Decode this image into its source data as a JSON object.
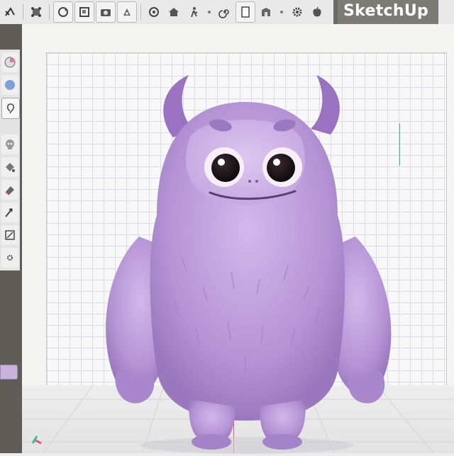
{
  "app": {
    "title": "SketchUp"
  },
  "toolbar": {
    "items": [
      {
        "name": "select-arrow-icon"
      },
      {
        "name": "component-icon"
      },
      {
        "name": "rotate-icon"
      },
      {
        "name": "frame-icon"
      },
      {
        "name": "camera-icon"
      },
      {
        "name": "paint-icon"
      },
      {
        "name": "orbit-icon"
      },
      {
        "name": "house-icon"
      },
      {
        "name": "walk-icon"
      },
      {
        "name": "spiral-icon"
      },
      {
        "name": "page-icon"
      },
      {
        "name": "warehouse-icon"
      },
      {
        "name": "gear-icon"
      },
      {
        "name": "apple-icon"
      }
    ]
  },
  "sidebar": {
    "tools": [
      {
        "name": "pie-chart-icon"
      },
      {
        "name": "sphere-icon"
      },
      {
        "name": "lasso-icon"
      },
      {
        "name": "skull-icon"
      },
      {
        "name": "paint-bucket-icon"
      },
      {
        "name": "eraser-icon"
      },
      {
        "name": "move-icon"
      },
      {
        "name": "scale-icon"
      },
      {
        "name": "small-gear-icon"
      }
    ],
    "swatch_color": "#c8b3dd"
  },
  "canvas": {
    "monster_color": "#b99ad8",
    "grid_color": "#d8dde3",
    "axis_red": "#d75a7a",
    "axis_green": "#3fb99a"
  }
}
